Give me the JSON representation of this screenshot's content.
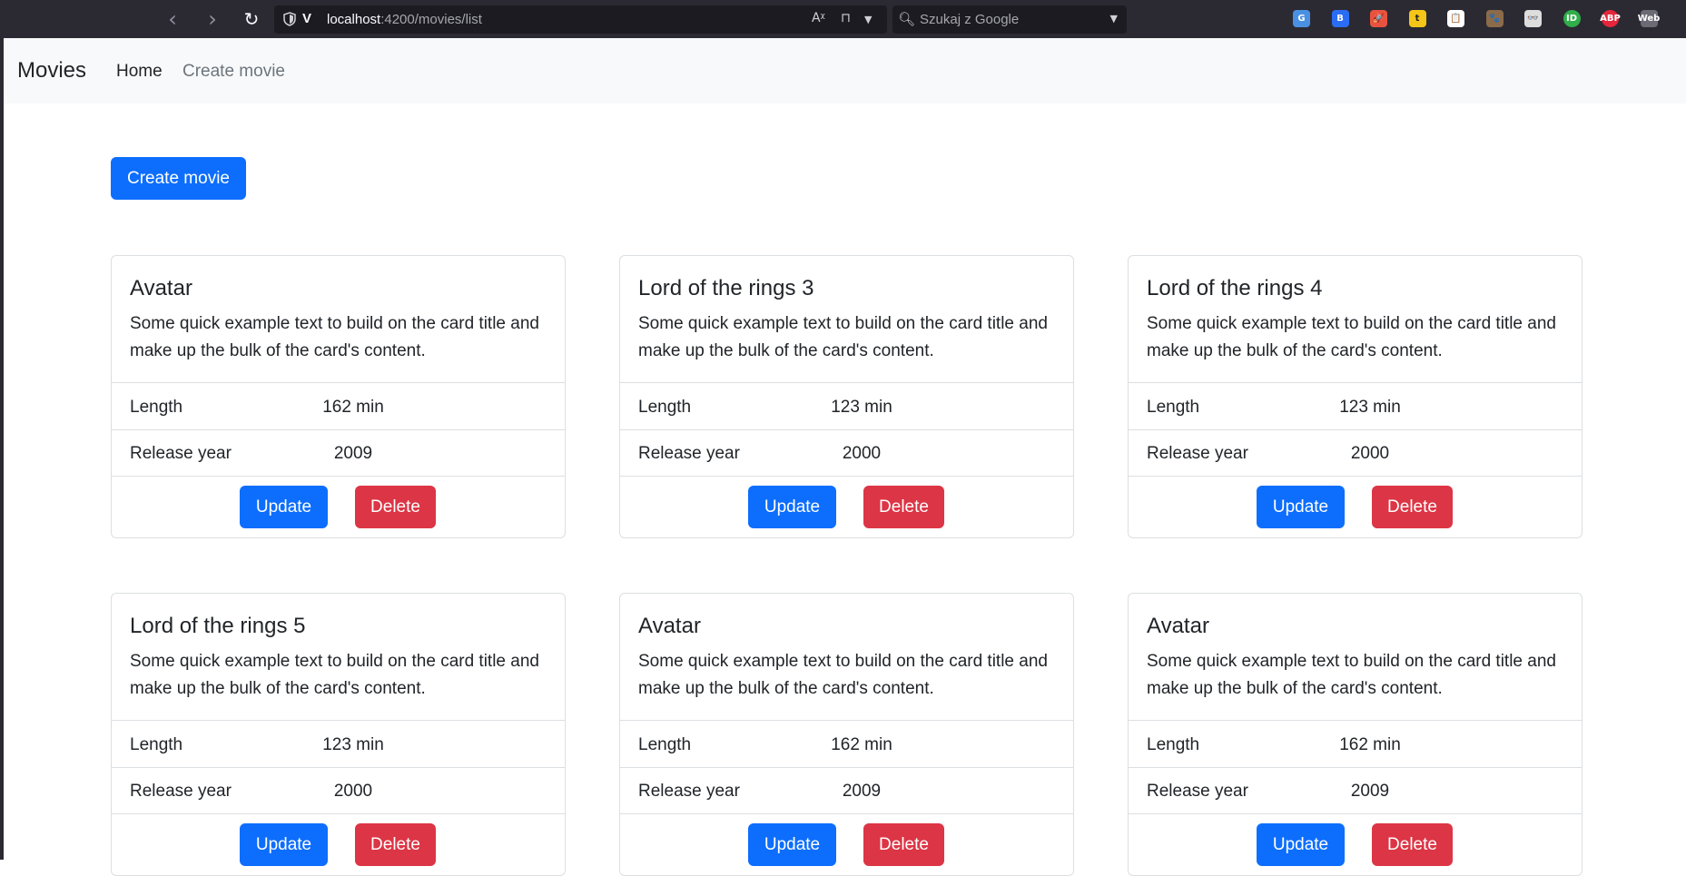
{
  "browser": {
    "url_host": "localhost",
    "url_path": ":4200/movies/list",
    "search_placeholder": "Szukaj z Google",
    "extensions": [
      "G",
      "B",
      "🚀",
      "t",
      "📋",
      "🐾",
      "👓",
      "ID",
      "ABP",
      "Web"
    ]
  },
  "navbar": {
    "brand": "Movies",
    "home_label": "Home",
    "create_label": "Create movie"
  },
  "create_button_label": "Create movie",
  "card_labels": {
    "length": "Length",
    "release_year": "Release year",
    "update": "Update",
    "delete": "Delete"
  },
  "movies": [
    {
      "title": "Avatar",
      "description": "Some quick example text to build on the card title and make up the bulk of the card's content.",
      "length": "162 min",
      "release_year": "2009"
    },
    {
      "title": "Lord of the rings 3",
      "description": "Some quick example text to build on the card title and make up the bulk of the card's content.",
      "length": "123 min",
      "release_year": "2000"
    },
    {
      "title": "Lord of the rings 4",
      "description": "Some quick example text to build on the card title and make up the bulk of the card's content.",
      "length": "123 min",
      "release_year": "2000"
    },
    {
      "title": "Lord of the rings 5",
      "description": "Some quick example text to build on the card title and make up the bulk of the card's content.",
      "length": "123 min",
      "release_year": "2000"
    },
    {
      "title": "Avatar",
      "description": "Some quick example text to build on the card title and make up the bulk of the card's content.",
      "length": "162 min",
      "release_year": "2009"
    },
    {
      "title": "Avatar",
      "description": "Some quick example text to build on the card title and make up the bulk of the card's content.",
      "length": "162 min",
      "release_year": "2009"
    }
  ],
  "colors": {
    "primary": "#0d6efd",
    "danger": "#dc3545",
    "navbar_bg": "#f8f9fa",
    "browser_chrome": "#2b2a33"
  }
}
